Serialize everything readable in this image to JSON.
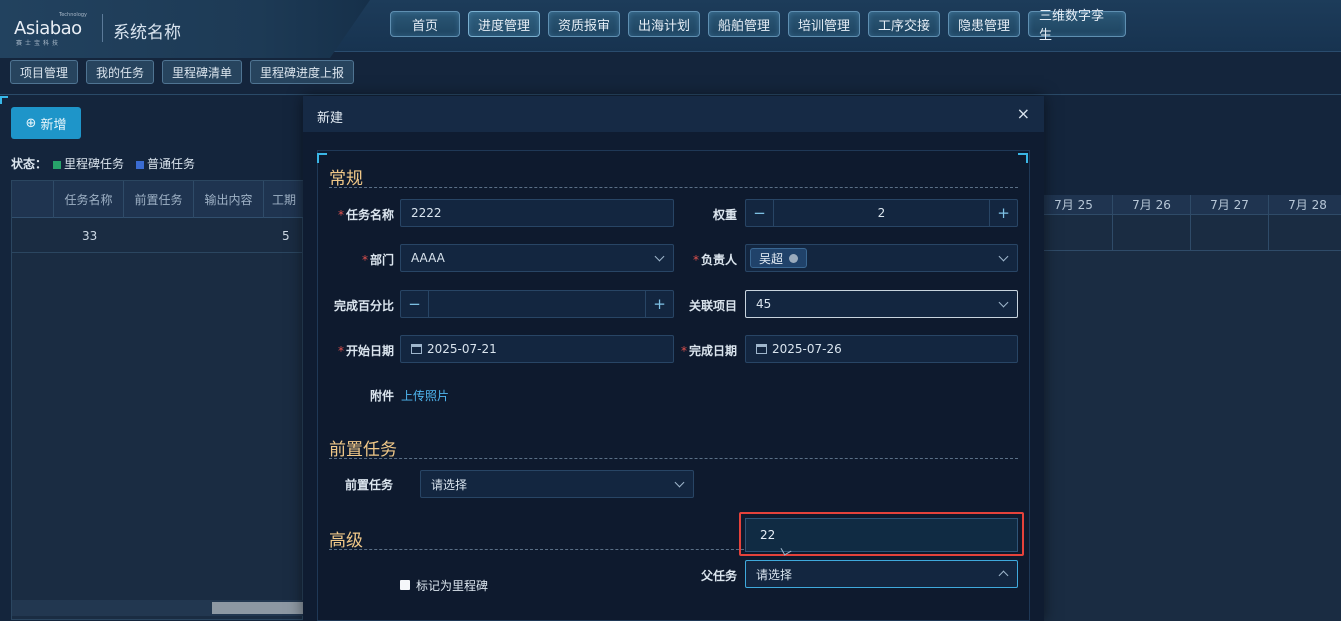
{
  "header": {
    "logo": {
      "main": "Asiabao",
      "sub": "赛士宝科技",
      "tech": "Technology"
    },
    "system_name": "系统名称",
    "nav": [
      "首页",
      "进度管理",
      "资质报审",
      "出海计划",
      "船舶管理",
      "培训管理",
      "工序交接",
      "隐患管理",
      "三维数字孪生"
    ],
    "active_nav": "进度管理"
  },
  "subnav": [
    "项目管理",
    "我的任务",
    "里程碑清单",
    "里程碑进度上报"
  ],
  "page": {
    "add_button": "新增",
    "status_label": "状态：",
    "status_items": [
      "里程碑任务",
      "普通任务"
    ],
    "status_colors": [
      "#27a36a",
      "#3a6bd1"
    ],
    "table_headers": [
      "任务名称",
      "前置任务",
      "输出内容",
      "工期"
    ],
    "table_row": [
      "33",
      "",
      "",
      "5"
    ],
    "gantt_dates": [
      "7月 25",
      "7月 26",
      "7月 27",
      "7月 28"
    ]
  },
  "modal": {
    "title": "新建",
    "close_icon": "×",
    "sections": {
      "general": "常规",
      "predecessor": "前置任务",
      "advanced": "高级"
    },
    "fields": {
      "task_name": {
        "label": "任务名称",
        "value": "2222",
        "required": true
      },
      "weight": {
        "label": "权重",
        "value": "2"
      },
      "department": {
        "label": "部门",
        "value": "AAAA",
        "required": true
      },
      "owner": {
        "label": "负责人",
        "value": "吴超",
        "required": true
      },
      "percent": {
        "label": "完成百分比",
        "value": ""
      },
      "project": {
        "label": "关联项目",
        "value": "45"
      },
      "start_date": {
        "label": "开始日期",
        "value": "2025-07-21",
        "required": true
      },
      "end_date": {
        "label": "完成日期",
        "value": "2025-07-26",
        "required": true
      },
      "attachment": {
        "label": "附件",
        "link": "上传照片"
      },
      "predecessor": {
        "label": "前置任务",
        "placeholder": "请选择"
      },
      "milestone": {
        "label": "标记为里程碑"
      },
      "parent": {
        "label": "父任务",
        "placeholder": "请选择"
      }
    },
    "dropdown_option": "22"
  }
}
